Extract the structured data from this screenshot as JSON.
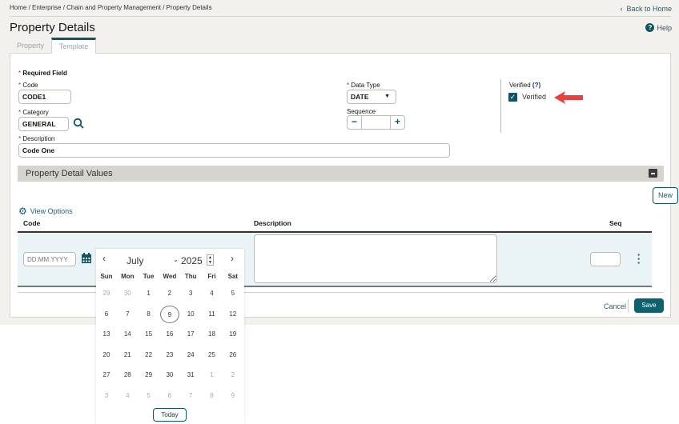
{
  "breadcrumb": "Home / Enterprise / Chain and Property Management / Property Details",
  "back_label": "Back to Home",
  "page_title": "Property Details",
  "help_label": "Help",
  "tabs": [
    {
      "label": "Property"
    },
    {
      "label": "Template"
    }
  ],
  "form": {
    "required_field": "Required Field",
    "code_label": "Code",
    "code_value": "CODE1",
    "category_label": "Category",
    "category_value": "GENERAL",
    "description_label": "Description",
    "description_value": "Code One",
    "data_type_label": "Data Type",
    "data_type_value": "DATE",
    "sequence_label": "Sequence",
    "sequence_value": "",
    "verified_label": "Verified",
    "verified_help": "(?)",
    "verified_checkbox_label": "Verified",
    "verified_checked": true
  },
  "section_title": "Property Detail Values",
  "new_label": "New",
  "view_options_label": "View Options",
  "table": {
    "columns": [
      "Code",
      "Description",
      "Seq"
    ],
    "code_placeholder": "DD.MM.YYYY"
  },
  "calendar": {
    "month": "July",
    "year": "2025",
    "weekdays": [
      "Sun",
      "Mon",
      "Tue",
      "Wed",
      "Thu",
      "Fri",
      "Sat"
    ],
    "weeks": [
      [
        "29",
        "30",
        "1",
        "2",
        "3",
        "4",
        "5"
      ],
      [
        "6",
        "7",
        "8",
        "9",
        "10",
        "11",
        "12"
      ],
      [
        "13",
        "14",
        "15",
        "16",
        "17",
        "18",
        "19"
      ],
      [
        "20",
        "21",
        "22",
        "23",
        "24",
        "25",
        "26"
      ],
      [
        "27",
        "28",
        "29",
        "30",
        "31",
        "1",
        "2"
      ],
      [
        "3",
        "4",
        "5",
        "6",
        "7",
        "8",
        "9"
      ]
    ],
    "selected": "9",
    "today_label": "Today"
  },
  "cancel_label": "Cancel",
  "save_label": "Save"
}
